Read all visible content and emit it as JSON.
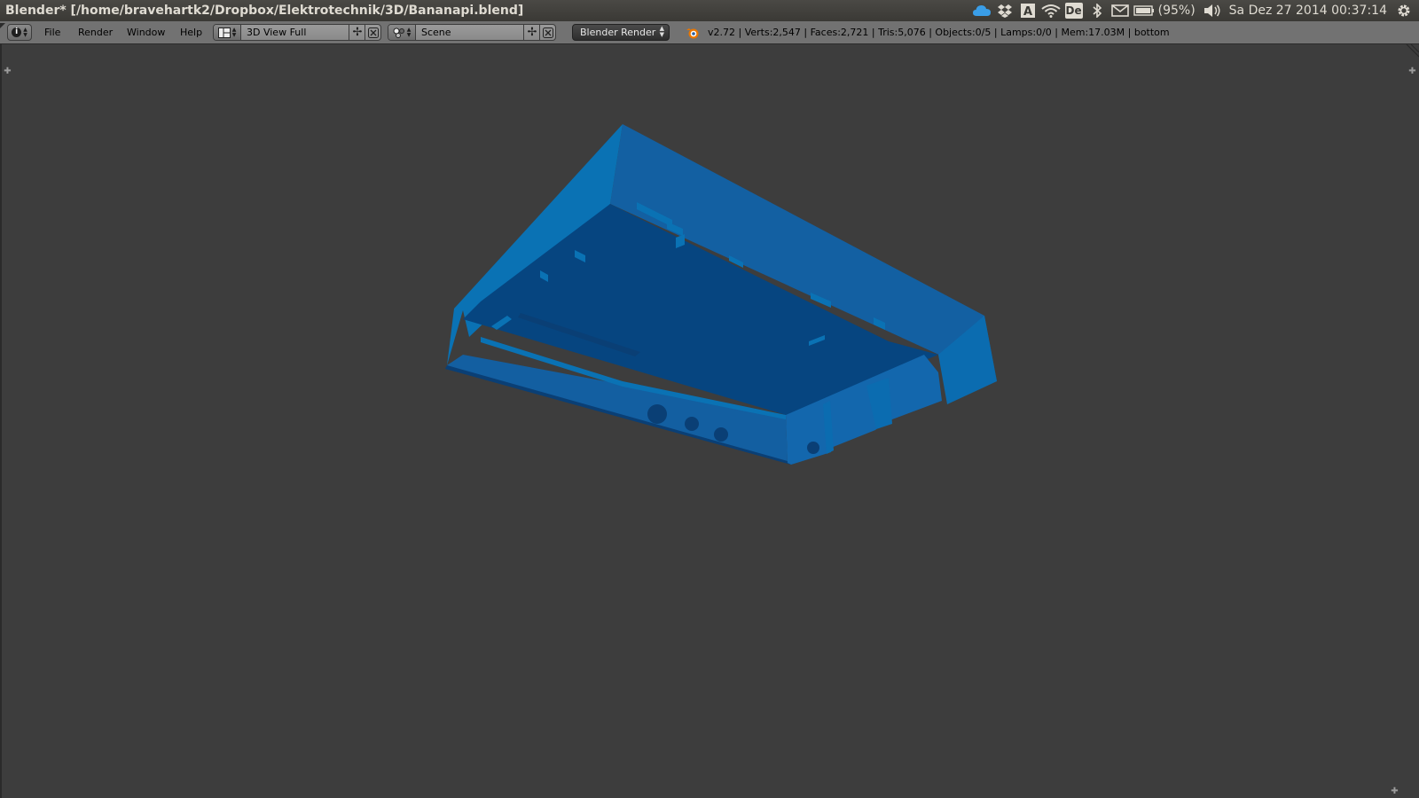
{
  "window": {
    "title": "Blender* [/home/bravehartk2/Dropbox/Elektrotechnik/3D/Bananapi.blend]"
  },
  "system_tray": {
    "battery_text": "(95%)",
    "keyboard_layout": "De",
    "datetime": "Sa Dez 27 2014 00:37:14",
    "icons": [
      "cloud-icon",
      "dropbox-icon",
      "text-a-icon",
      "wifi-icon",
      "keyboard-layout-icon",
      "bluetooth-icon",
      "mail-icon",
      "battery-icon",
      "volume-icon",
      "gear-icon"
    ]
  },
  "info_header": {
    "menus": [
      "File",
      "Render",
      "Window",
      "Help"
    ],
    "screen_layout": "3D View Full",
    "scene": "Scene",
    "render_engine": "Blender Render",
    "stats": "v2.72 | Verts:2,547 | Faces:2,721 | Tris:5,076 | Objects:0/5 | Lamps:0/0 | Mem:17.03M | bottom"
  },
  "viewport": {
    "background_color": "#3d3d3d",
    "object_colors": {
      "left_wall": "#0a72b4",
      "back_wall": "#1360a2",
      "floor": "#064580",
      "front_wall": "#135fa1",
      "right_front_wall": "#1367ad",
      "right_wall": "#0b6cb0",
      "edge_dark": "#0a3f75"
    }
  }
}
